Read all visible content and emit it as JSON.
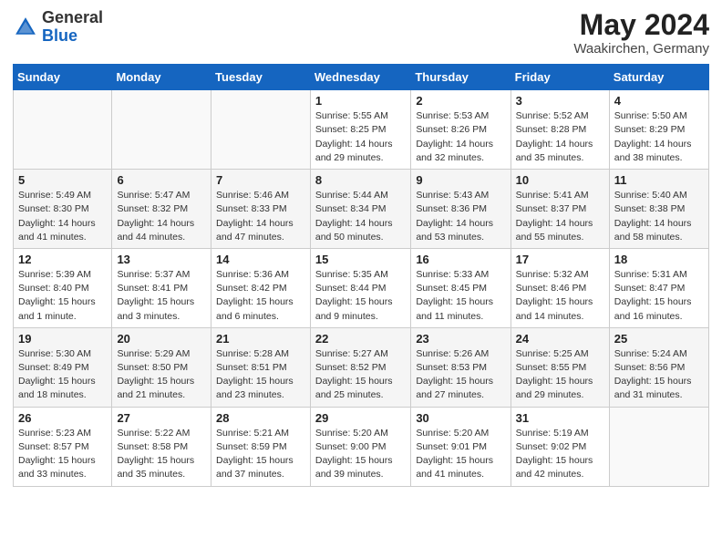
{
  "logo": {
    "general": "General",
    "blue": "Blue"
  },
  "header": {
    "monthYear": "May 2024",
    "location": "Waakirchen, Germany"
  },
  "columns": [
    "Sunday",
    "Monday",
    "Tuesday",
    "Wednesday",
    "Thursday",
    "Friday",
    "Saturday"
  ],
  "weeks": [
    [
      {
        "day": "",
        "info": ""
      },
      {
        "day": "",
        "info": ""
      },
      {
        "day": "",
        "info": ""
      },
      {
        "day": "1",
        "info": "Sunrise: 5:55 AM\nSunset: 8:25 PM\nDaylight: 14 hours\nand 29 minutes."
      },
      {
        "day": "2",
        "info": "Sunrise: 5:53 AM\nSunset: 8:26 PM\nDaylight: 14 hours\nand 32 minutes."
      },
      {
        "day": "3",
        "info": "Sunrise: 5:52 AM\nSunset: 8:28 PM\nDaylight: 14 hours\nand 35 minutes."
      },
      {
        "day": "4",
        "info": "Sunrise: 5:50 AM\nSunset: 8:29 PM\nDaylight: 14 hours\nand 38 minutes."
      }
    ],
    [
      {
        "day": "5",
        "info": "Sunrise: 5:49 AM\nSunset: 8:30 PM\nDaylight: 14 hours\nand 41 minutes."
      },
      {
        "day": "6",
        "info": "Sunrise: 5:47 AM\nSunset: 8:32 PM\nDaylight: 14 hours\nand 44 minutes."
      },
      {
        "day": "7",
        "info": "Sunrise: 5:46 AM\nSunset: 8:33 PM\nDaylight: 14 hours\nand 47 minutes."
      },
      {
        "day": "8",
        "info": "Sunrise: 5:44 AM\nSunset: 8:34 PM\nDaylight: 14 hours\nand 50 minutes."
      },
      {
        "day": "9",
        "info": "Sunrise: 5:43 AM\nSunset: 8:36 PM\nDaylight: 14 hours\nand 53 minutes."
      },
      {
        "day": "10",
        "info": "Sunrise: 5:41 AM\nSunset: 8:37 PM\nDaylight: 14 hours\nand 55 minutes."
      },
      {
        "day": "11",
        "info": "Sunrise: 5:40 AM\nSunset: 8:38 PM\nDaylight: 14 hours\nand 58 minutes."
      }
    ],
    [
      {
        "day": "12",
        "info": "Sunrise: 5:39 AM\nSunset: 8:40 PM\nDaylight: 15 hours\nand 1 minute."
      },
      {
        "day": "13",
        "info": "Sunrise: 5:37 AM\nSunset: 8:41 PM\nDaylight: 15 hours\nand 3 minutes."
      },
      {
        "day": "14",
        "info": "Sunrise: 5:36 AM\nSunset: 8:42 PM\nDaylight: 15 hours\nand 6 minutes."
      },
      {
        "day": "15",
        "info": "Sunrise: 5:35 AM\nSunset: 8:44 PM\nDaylight: 15 hours\nand 9 minutes."
      },
      {
        "day": "16",
        "info": "Sunrise: 5:33 AM\nSunset: 8:45 PM\nDaylight: 15 hours\nand 11 minutes."
      },
      {
        "day": "17",
        "info": "Sunrise: 5:32 AM\nSunset: 8:46 PM\nDaylight: 15 hours\nand 14 minutes."
      },
      {
        "day": "18",
        "info": "Sunrise: 5:31 AM\nSunset: 8:47 PM\nDaylight: 15 hours\nand 16 minutes."
      }
    ],
    [
      {
        "day": "19",
        "info": "Sunrise: 5:30 AM\nSunset: 8:49 PM\nDaylight: 15 hours\nand 18 minutes."
      },
      {
        "day": "20",
        "info": "Sunrise: 5:29 AM\nSunset: 8:50 PM\nDaylight: 15 hours\nand 21 minutes."
      },
      {
        "day": "21",
        "info": "Sunrise: 5:28 AM\nSunset: 8:51 PM\nDaylight: 15 hours\nand 23 minutes."
      },
      {
        "day": "22",
        "info": "Sunrise: 5:27 AM\nSunset: 8:52 PM\nDaylight: 15 hours\nand 25 minutes."
      },
      {
        "day": "23",
        "info": "Sunrise: 5:26 AM\nSunset: 8:53 PM\nDaylight: 15 hours\nand 27 minutes."
      },
      {
        "day": "24",
        "info": "Sunrise: 5:25 AM\nSunset: 8:55 PM\nDaylight: 15 hours\nand 29 minutes."
      },
      {
        "day": "25",
        "info": "Sunrise: 5:24 AM\nSunset: 8:56 PM\nDaylight: 15 hours\nand 31 minutes."
      }
    ],
    [
      {
        "day": "26",
        "info": "Sunrise: 5:23 AM\nSunset: 8:57 PM\nDaylight: 15 hours\nand 33 minutes."
      },
      {
        "day": "27",
        "info": "Sunrise: 5:22 AM\nSunset: 8:58 PM\nDaylight: 15 hours\nand 35 minutes."
      },
      {
        "day": "28",
        "info": "Sunrise: 5:21 AM\nSunset: 8:59 PM\nDaylight: 15 hours\nand 37 minutes."
      },
      {
        "day": "29",
        "info": "Sunrise: 5:20 AM\nSunset: 9:00 PM\nDaylight: 15 hours\nand 39 minutes."
      },
      {
        "day": "30",
        "info": "Sunrise: 5:20 AM\nSunset: 9:01 PM\nDaylight: 15 hours\nand 41 minutes."
      },
      {
        "day": "31",
        "info": "Sunrise: 5:19 AM\nSunset: 9:02 PM\nDaylight: 15 hours\nand 42 minutes."
      },
      {
        "day": "",
        "info": ""
      }
    ]
  ]
}
